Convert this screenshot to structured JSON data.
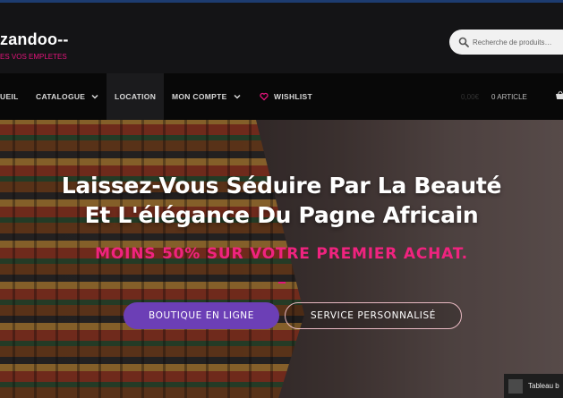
{
  "header": {
    "brand": "zandoo--",
    "tagline": "ES VOS EMPLETES",
    "search": {
      "placeholder": "Recherche de produits…"
    }
  },
  "nav": {
    "items": [
      {
        "label": "UEIL"
      },
      {
        "label": "CATALOGUE"
      },
      {
        "label": "LOCATION"
      },
      {
        "label": "MON COMPTE"
      },
      {
        "label": "WISHLIST"
      }
    ],
    "cart": {
      "amount": "0,00€",
      "count": "0 ARTICLE"
    }
  },
  "hero": {
    "headline_line1": "Laissez-Vous Séduire Par La Beauté",
    "headline_line2": "Et L'élégance Du Pagne Africain",
    "promo": "MOINS 50% SUR VOTRE PREMIER ACHAT.",
    "primary_button": "BOUTIQUE EN LIGNE",
    "secondary_button": "SERVICE PERSONNALISÉ"
  },
  "widget": {
    "label": "Tableau b"
  },
  "colors": {
    "accent_pink": "#e3147b",
    "button_purple": "#6c3fb6",
    "nav_bg": "#080808",
    "header_bg": "#141416"
  }
}
